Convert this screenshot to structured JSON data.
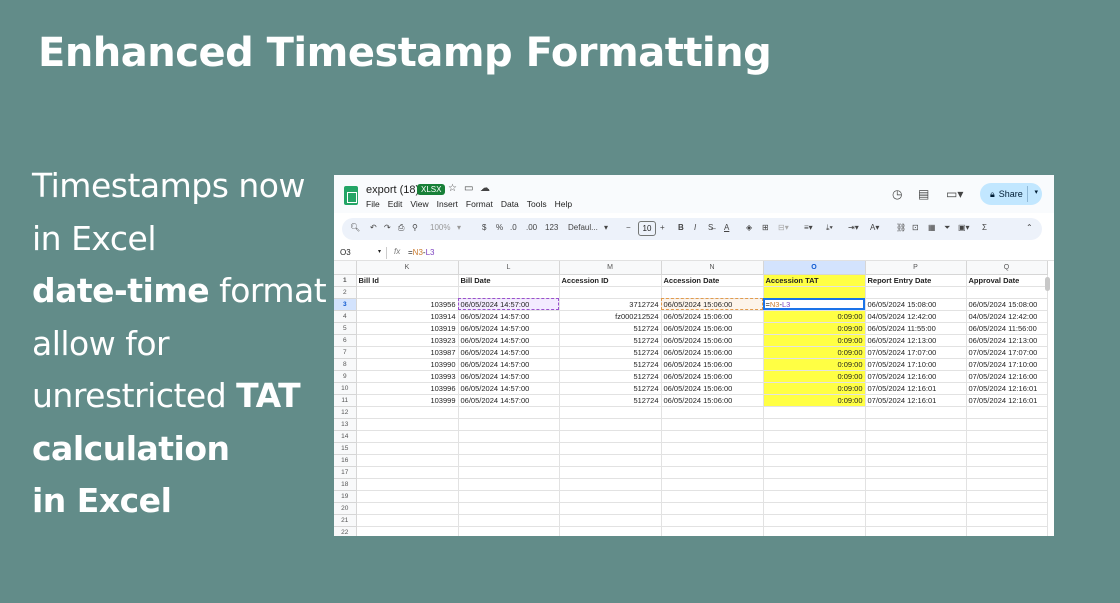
{
  "slide": {
    "title": "Enhanced Timestamp Formatting",
    "body": {
      "l1": "Timestamps now",
      "l2": "in Excel",
      "l3_bold": "date-time",
      "l3_rest": " format",
      "l4": "allow for",
      "l5_pre": "unrestricted ",
      "l5_bold": "TAT",
      "l6": "calculation",
      "l7": "in Excel"
    }
  },
  "app": {
    "doc_title": "export (18)",
    "file_badge": "XLSX",
    "menus": [
      "File",
      "Edit",
      "View",
      "Insert",
      "Format",
      "Data",
      "Tools",
      "Help"
    ],
    "share_label": "Share",
    "toolbar": {
      "zoom": "100%",
      "currency": "$",
      "percent": "%",
      "dec_less": ".0",
      "dec_more": ".00",
      "num_format": "123",
      "font": "Defaul...",
      "font_size": "10",
      "bold": "B",
      "italic": "I",
      "text_color": "A",
      "sum": "Σ"
    },
    "formula_bar": {
      "name_box": "O3",
      "fx": "fx",
      "formula_eq": "=",
      "formula_r1": "N3",
      "formula_op": "-",
      "formula_r2": "L3"
    }
  },
  "sheet": {
    "columns": [
      "K",
      "L",
      "M",
      "N",
      "O",
      "P",
      "Q"
    ],
    "headers": [
      "Bill Id",
      "Bill Date",
      "Accession ID",
      "Accession Date",
      "Accession TAT",
      "Report Entry Date",
      "Approval Date"
    ],
    "rows": [
      {
        "n": "1"
      },
      {
        "n": "2",
        "cells": [
          "",
          "",
          "",
          "",
          "",
          "",
          ""
        ]
      },
      {
        "n": "3",
        "cells": [
          "103956",
          "06/05/2024 14:57:00",
          "3712724",
          "06/05/2024 15:06:00",
          "",
          "06/05/2024 15:08:00",
          "06/05/2024 15:08:00"
        ]
      },
      {
        "n": "4",
        "cells": [
          "103914",
          "06/05/2024 14:57:00",
          "fz000212524",
          "06/05/2024 15:06:00",
          "0:09:00",
          "04/05/2024 12:42:00",
          "04/05/2024 12:42:00"
        ]
      },
      {
        "n": "5",
        "cells": [
          "103919",
          "06/05/2024 14:57:00",
          "512724",
          "06/05/2024 15:06:00",
          "0:09:00",
          "06/05/2024 11:55:00",
          "06/05/2024 11:56:00"
        ]
      },
      {
        "n": "6",
        "cells": [
          "103923",
          "06/05/2024 14:57:00",
          "512724",
          "06/05/2024 15:06:00",
          "0:09:00",
          "06/05/2024 12:13:00",
          "06/05/2024 12:13:00"
        ]
      },
      {
        "n": "7",
        "cells": [
          "103987",
          "06/05/2024 14:57:00",
          "512724",
          "06/05/2024 15:06:00",
          "0:09:00",
          "07/05/2024 17:07:00",
          "07/05/2024 17:07:00"
        ]
      },
      {
        "n": "8",
        "cells": [
          "103990",
          "06/05/2024 14:57:00",
          "512724",
          "06/05/2024 15:06:00",
          "0:09:00",
          "07/05/2024 17:10:00",
          "07/05/2024 17:10:00"
        ]
      },
      {
        "n": "9",
        "cells": [
          "103993",
          "06/05/2024 14:57:00",
          "512724",
          "06/05/2024 15:06:00",
          "0:09:00",
          "07/05/2024 12:16:00",
          "07/05/2024 12:16:00"
        ]
      },
      {
        "n": "10",
        "cells": [
          "103996",
          "06/05/2024 14:57:00",
          "512724",
          "06/05/2024 15:06:00",
          "0:09:00",
          "07/05/2024 12:16:01",
          "07/05/2024 12:16:01"
        ]
      },
      {
        "n": "11",
        "cells": [
          "103999",
          "06/05/2024 14:57:00",
          "512724",
          "06/05/2024 15:06:00",
          "0:09:00",
          "07/05/2024 12:16:01",
          "07/05/2024 12:16:01"
        ]
      }
    ],
    "empty_row_numbers": [
      "12",
      "13",
      "14",
      "15",
      "16",
      "17",
      "18",
      "19",
      "20",
      "21",
      "22"
    ],
    "active_cell": {
      "ref": "O3",
      "hint": "?"
    },
    "colors": {
      "highlight": "#ffff44",
      "selection": "#1a73e8",
      "background": "#628c89"
    }
  }
}
